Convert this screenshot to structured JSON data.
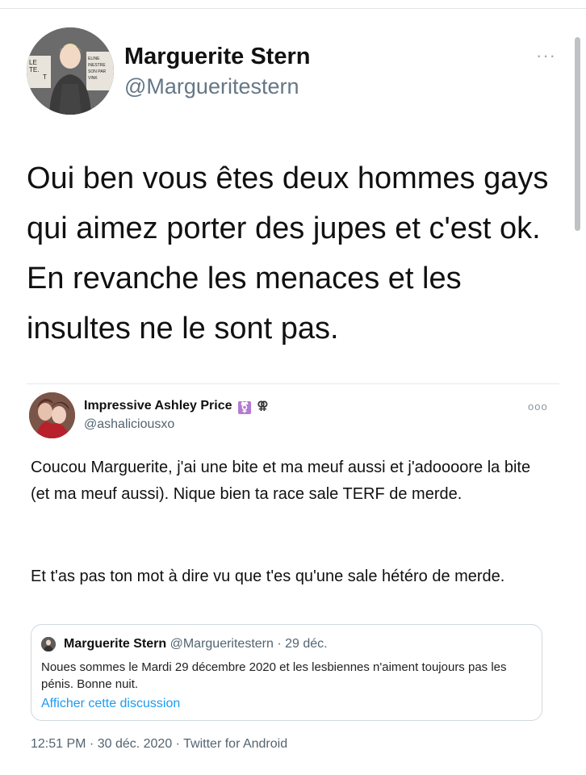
{
  "tweet": {
    "author_name": "Marguerite Stern",
    "author_handle": "@Margueritestern",
    "more_icon": "···",
    "text": "Oui ben vous êtes deux hommes gays qui aimez porter des jupes et c'est ok. En revanche les menaces et les insultes ne le sont pas.",
    "avatar_sign_left": [
      "LE",
      "TE.",
      "T"
    ],
    "avatar_sign_right": [
      "ELINE",
      "INESTRE",
      "SON PAR",
      "VINK"
    ]
  },
  "retweeted": {
    "author_name": "Impressive Ashley Price",
    "badge_icon": "⚧",
    "badge_icon_2": "⚢",
    "author_handle": "@ashaliciousxo",
    "more_icon": "ooo",
    "paragraph_1": "Coucou Marguerite, j'ai une bite et ma meuf aussi et j'adoooore la bite (et ma meuf aussi). Nique bien ta race sale TERF de merde.",
    "paragraph_2": "Et t'as pas ton mot à dire vu que t'es qu'une sale hétéro de merde.",
    "footer": "12:51 PM · 30 déc. 2020 · Twitter for Android"
  },
  "embedded": {
    "author_name": "Marguerite Stern",
    "author_handle_date": "@Margueritestern · 29 déc.",
    "text": "Noues sommes le Mardi 29 décembre 2020 et les lesbiennes n'aiment toujours pas les pénis. Bonne nuit.",
    "link": "Afficher cette discussion"
  },
  "colors": {
    "link": "#1d9bf0",
    "secondary_text": "#536471",
    "border": "#cfd9de",
    "badge": "#b47bd1"
  }
}
